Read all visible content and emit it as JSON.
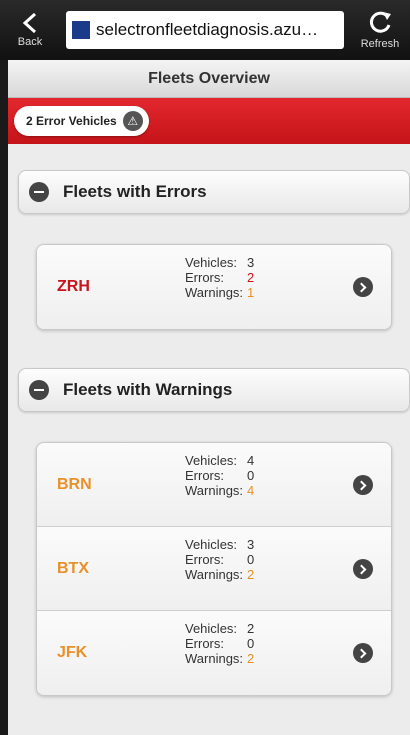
{
  "browser": {
    "back_label": "Back",
    "url": "selectronfleetdiagnosis.azu…",
    "refresh_label": "Refresh"
  },
  "page": {
    "title": "Fleets Overview",
    "error_summary": "2 Error Vehicles"
  },
  "colors": {
    "error": "#c8141c",
    "warning": "#e8902a"
  },
  "sections": [
    {
      "title": "Fleets with Errors",
      "fleets": [
        {
          "code": "ZRH",
          "code_color": "error",
          "vehicles_label": "Vehicles:",
          "vehicles": "3",
          "errors_label": "Errors:",
          "errors": "2",
          "warnings_label": "Warnings:",
          "warnings": "1"
        }
      ]
    },
    {
      "title": "Fleets with Warnings",
      "fleets": [
        {
          "code": "BRN",
          "code_color": "warning",
          "vehicles_label": "Vehicles:",
          "vehicles": "4",
          "errors_label": "Errors:",
          "errors": "0",
          "warnings_label": "Warnings:",
          "warnings": "4"
        },
        {
          "code": "BTX",
          "code_color": "warning",
          "vehicles_label": "Vehicles:",
          "vehicles": "3",
          "errors_label": "Errors:",
          "errors": "0",
          "warnings_label": "Warnings:",
          "warnings": "2"
        },
        {
          "code": "JFK",
          "code_color": "warning",
          "vehicles_label": "Vehicles:",
          "vehicles": "2",
          "errors_label": "Errors:",
          "errors": "0",
          "warnings_label": "Warnings:",
          "warnings": "2"
        }
      ]
    }
  ]
}
